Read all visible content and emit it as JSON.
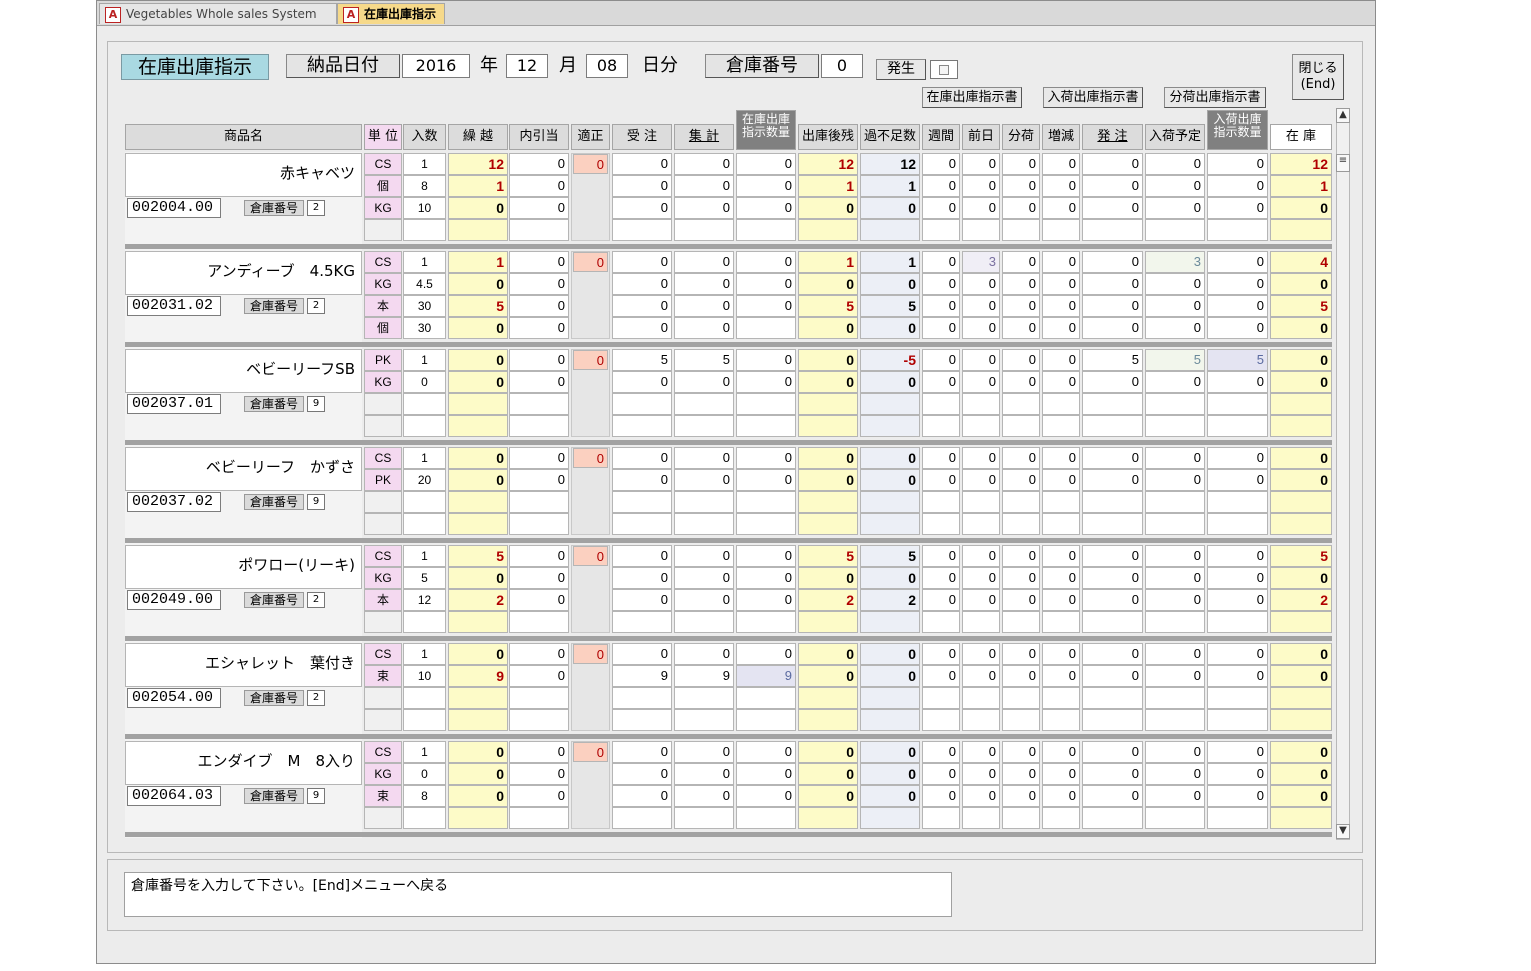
{
  "window_tabs": [
    {
      "label": "Vegetables Whole sales System",
      "icon": "access-form-icon"
    },
    {
      "label": "在庫出庫指示",
      "icon": "access-form-icon"
    }
  ],
  "header": {
    "form_title": "在庫出庫指示",
    "delivery_date_label": "納品日付",
    "year_value": "2016",
    "year_label": "年",
    "month_value": "12",
    "month_label": "月",
    "day_value": "08",
    "day_label": "日分",
    "warehouse_label": "倉庫番号",
    "warehouse_value": "0",
    "hassei_label": "発生",
    "close_label_1": "閉じる",
    "close_label_2": "(End)"
  },
  "report_buttons": [
    "在庫出庫指示書",
    "入荷出庫指示書",
    "分荷出庫指示書"
  ],
  "columns": {
    "name": "商品名",
    "unit": "単 位",
    "iri": "入数",
    "kurikoshi": "繰 越",
    "uchihikiate": "内引当",
    "tekisei": "適正",
    "juchu": "受 注",
    "shukei": "集 計",
    "zaiko_shiji_1": "在庫出庫",
    "zaiko_shiji_2": "指示数量",
    "shukkogo": "出庫後残",
    "kafusoku": "過不足数",
    "shukan": "週間",
    "zenjitsu": "前日",
    "bunka": "分荷",
    "zogen": "増減",
    "hatchu": "発 注",
    "nyuka_yotei": "入荷予定",
    "nyuka_shiji_1": "入荷出庫",
    "nyuka_shiji_2": "指示数量",
    "zaiko": "在 庫"
  },
  "products": [
    {
      "name": "赤キャベツ",
      "code": "002004.00",
      "wh_label": "倉庫番号",
      "wh": "2",
      "tekisei": "0",
      "rows": [
        {
          "unit": "CS",
          "iri": "1",
          "kuri": "12",
          "uchi": "0",
          "juchu": "0",
          "shukei": "0",
          "zshiji": "0",
          "zan": "12",
          "kafu": "12",
          "shu": "0",
          "zen": "0",
          "bun": "0",
          "zo": "0",
          "hat": "0",
          "yot": "0",
          "nshiji": "0",
          "zaiko": "12"
        },
        {
          "unit": "個",
          "iri": "8",
          "kuri": "1",
          "uchi": "0",
          "juchu": "0",
          "shukei": "0",
          "zshiji": "0",
          "zan": "1",
          "kafu": "1",
          "shu": "0",
          "zen": "0",
          "bun": "0",
          "zo": "0",
          "hat": "0",
          "yot": "0",
          "nshiji": "0",
          "zaiko": "1"
        },
        {
          "unit": "KG",
          "iri": "10",
          "kuri": "0",
          "uchi": "0",
          "juchu": "0",
          "shukei": "0",
          "zshiji": "0",
          "zan": "0",
          "kafu": "0",
          "shu": "0",
          "zen": "0",
          "bun": "0",
          "zo": "0",
          "hat": "0",
          "yot": "0",
          "nshiji": "0",
          "zaiko": "0"
        }
      ]
    },
    {
      "name": "アンディーブ　4.5KG",
      "code": "002031.02",
      "wh_label": "倉庫番号",
      "wh": "2",
      "tekisei": "0",
      "rows": [
        {
          "unit": "CS",
          "iri": "1",
          "kuri": "1",
          "uchi": "0",
          "juchu": "0",
          "shukei": "0",
          "zshiji": "0",
          "zan": "1",
          "kafu": "1",
          "shu": "0",
          "zen": "3",
          "bun": "0",
          "zo": "0",
          "hat": "0",
          "yot": "3",
          "nshiji": "0",
          "zaiko": "4"
        },
        {
          "unit": "KG",
          "iri": "4.5",
          "kuri": "0",
          "uchi": "0",
          "juchu": "0",
          "shukei": "0",
          "zshiji": "0",
          "zan": "0",
          "kafu": "0",
          "shu": "0",
          "zen": "0",
          "bun": "0",
          "zo": "0",
          "hat": "0",
          "yot": "0",
          "nshiji": "0",
          "zaiko": "0"
        },
        {
          "unit": "本",
          "iri": "30",
          "kuri": "5",
          "uchi": "0",
          "juchu": "0",
          "shukei": "0",
          "zshiji": "0",
          "zan": "5",
          "kafu": "5",
          "shu": "0",
          "zen": "0",
          "bun": "0",
          "zo": "0",
          "hat": "0",
          "yot": "0",
          "nshiji": "0",
          "zaiko": "5"
        },
        {
          "unit": "個",
          "iri": "30",
          "kuri": "0",
          "uchi": "0",
          "juchu": "0",
          "shukei": "0",
          "zshiji": "",
          "zan": "0",
          "kafu": "0",
          "shu": "0",
          "zen": "0",
          "bun": "0",
          "zo": "0",
          "hat": "0",
          "yot": "0",
          "nshiji": "0",
          "zaiko": "0"
        }
      ]
    },
    {
      "name": "ベビーリーフSB",
      "code": "002037.01",
      "wh_label": "倉庫番号",
      "wh": "9",
      "tekisei": "0",
      "rows": [
        {
          "unit": "PK",
          "iri": "1",
          "kuri": "0",
          "uchi": "0",
          "juchu": "5",
          "shukei": "5",
          "zshiji": "0",
          "zan": "0",
          "kafu": "-5",
          "shu": "0",
          "zen": "0",
          "bun": "0",
          "zo": "0",
          "hat": "5",
          "yot": "5",
          "nshiji": "5",
          "zaiko": "0"
        },
        {
          "unit": "KG",
          "iri": "0",
          "kuri": "0",
          "uchi": "0",
          "juchu": "0",
          "shukei": "0",
          "zshiji": "0",
          "zan": "0",
          "kafu": "0",
          "shu": "0",
          "zen": "0",
          "bun": "0",
          "zo": "0",
          "hat": "0",
          "yot": "0",
          "nshiji": "0",
          "zaiko": "0"
        }
      ]
    },
    {
      "name": "ベビーリーフ　かずさ",
      "code": "002037.02",
      "wh_label": "倉庫番号",
      "wh": "9",
      "tekisei": "0",
      "rows": [
        {
          "unit": "CS",
          "iri": "1",
          "kuri": "0",
          "uchi": "0",
          "juchu": "0",
          "shukei": "0",
          "zshiji": "0",
          "zan": "0",
          "kafu": "0",
          "shu": "0",
          "zen": "0",
          "bun": "0",
          "zo": "0",
          "hat": "0",
          "yot": "0",
          "nshiji": "0",
          "zaiko": "0"
        },
        {
          "unit": "PK",
          "iri": "20",
          "kuri": "0",
          "uchi": "0",
          "juchu": "0",
          "shukei": "0",
          "zshiji": "0",
          "zan": "0",
          "kafu": "0",
          "shu": "0",
          "zen": "0",
          "bun": "0",
          "zo": "0",
          "hat": "0",
          "yot": "0",
          "nshiji": "0",
          "zaiko": "0"
        }
      ]
    },
    {
      "name": "ポワロー(リーキ)",
      "code": "002049.00",
      "wh_label": "倉庫番号",
      "wh": "2",
      "tekisei": "0",
      "rows": [
        {
          "unit": "CS",
          "iri": "1",
          "kuri": "5",
          "uchi": "0",
          "juchu": "0",
          "shukei": "0",
          "zshiji": "0",
          "zan": "5",
          "kafu": "5",
          "shu": "0",
          "zen": "0",
          "bun": "0",
          "zo": "0",
          "hat": "0",
          "yot": "0",
          "nshiji": "0",
          "zaiko": "5"
        },
        {
          "unit": "KG",
          "iri": "5",
          "kuri": "0",
          "uchi": "0",
          "juchu": "0",
          "shukei": "0",
          "zshiji": "0",
          "zan": "0",
          "kafu": "0",
          "shu": "0",
          "zen": "0",
          "bun": "0",
          "zo": "0",
          "hat": "0",
          "yot": "0",
          "nshiji": "0",
          "zaiko": "0"
        },
        {
          "unit": "本",
          "iri": "12",
          "kuri": "2",
          "uchi": "0",
          "juchu": "0",
          "shukei": "0",
          "zshiji": "0",
          "zan": "2",
          "kafu": "2",
          "shu": "0",
          "zen": "0",
          "bun": "0",
          "zo": "0",
          "hat": "0",
          "yot": "0",
          "nshiji": "0",
          "zaiko": "2"
        }
      ]
    },
    {
      "name": "エシャレット　葉付き",
      "code": "002054.00",
      "wh_label": "倉庫番号",
      "wh": "2",
      "tekisei": "0",
      "rows": [
        {
          "unit": "CS",
          "iri": "1",
          "kuri": "0",
          "uchi": "0",
          "juchu": "0",
          "shukei": "0",
          "zshiji": "0",
          "zan": "0",
          "kafu": "0",
          "shu": "0",
          "zen": "0",
          "bun": "0",
          "zo": "0",
          "hat": "0",
          "yot": "0",
          "nshiji": "0",
          "zaiko": "0"
        },
        {
          "unit": "束",
          "iri": "10",
          "kuri": "9",
          "uchi": "0",
          "juchu": "9",
          "shukei": "9",
          "zshiji": "9",
          "zan": "0",
          "kafu": "0",
          "shu": "0",
          "zen": "0",
          "bun": "0",
          "zo": "0",
          "hat": "0",
          "yot": "0",
          "nshiji": "0",
          "zaiko": "0"
        }
      ]
    },
    {
      "name": "エンダイブ　M　8入り",
      "code": "002064.03",
      "wh_label": "倉庫番号",
      "wh": "9",
      "tekisei": "0",
      "rows": [
        {
          "unit": "CS",
          "iri": "1",
          "kuri": "0",
          "uchi": "0",
          "juchu": "0",
          "shukei": "0",
          "zshiji": "0",
          "zan": "0",
          "kafu": "0",
          "shu": "0",
          "zen": "0",
          "bun": "0",
          "zo": "0",
          "hat": "0",
          "yot": "0",
          "nshiji": "0",
          "zaiko": "0"
        },
        {
          "unit": "KG",
          "iri": "0",
          "kuri": "0",
          "uchi": "0",
          "juchu": "0",
          "shukei": "0",
          "zshiji": "0",
          "zan": "0",
          "kafu": "0",
          "shu": "0",
          "zen": "0",
          "bun": "0",
          "zo": "0",
          "hat": "0",
          "yot": "0",
          "nshiji": "0",
          "zaiko": "0"
        },
        {
          "unit": "束",
          "iri": "8",
          "kuri": "0",
          "uchi": "0",
          "juchu": "0",
          "shukei": "0",
          "zshiji": "0",
          "zan": "0",
          "kafu": "0",
          "shu": "0",
          "zen": "0",
          "bun": "0",
          "zo": "0",
          "hat": "0",
          "yot": "0",
          "nshiji": "0",
          "zaiko": "0"
        }
      ]
    }
  ],
  "status_message": "倉庫番号を入力して下さい。[End]メニューへ戻る",
  "colors": {
    "title_bg": "#a9d9e2",
    "kurikoshi_bg": "#fdfbc8",
    "tekisei_bg": "#fbd0c0",
    "unit_bg": "#f4d9f0",
    "kafusoku_bg": "#eceff6",
    "value_red": "#b00000",
    "active_tab": "#f6d98a"
  }
}
